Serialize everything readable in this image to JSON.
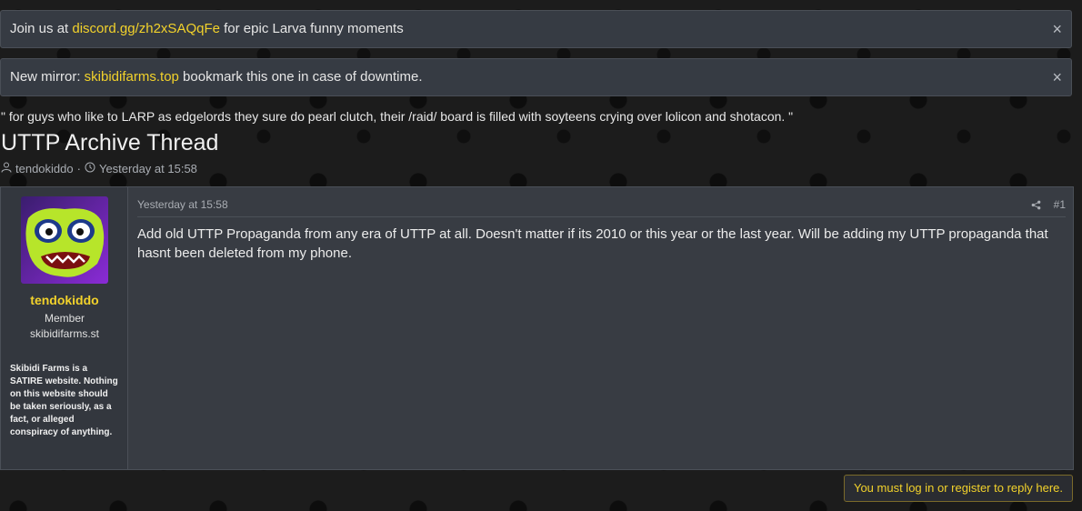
{
  "notices": [
    {
      "prefix": "Join us at ",
      "link": "discord.gg/zh2xSAQqFe",
      "suffix": " for epic Larva funny moments",
      "close_label": "×"
    },
    {
      "prefix": "New mirror: ",
      "link": "skibidifarms.top",
      "suffix": " bookmark this one in case of downtime.",
      "close_label": "×"
    }
  ],
  "quote": "\" for guys who like to LARP as edgelords they sure do pearl clutch, their /raid/ board is filled with soyteens crying over lolicon and shotacon. \"",
  "thread": {
    "title": "UTTP Archive Thread",
    "author": "tendokiddo",
    "separator": "·",
    "date": "Yesterday at 15:58"
  },
  "post": {
    "user": {
      "name": "tendokiddo",
      "title": "Member",
      "site": "skibidifarms.st",
      "disclaimer": "Skibidi Farms is a SATIRE website. Nothing on this website should be taken seriously, as a fact, or alleged conspiracy of anything."
    },
    "time": "Yesterday at 15:58",
    "number": "#1",
    "body": "Add old UTTP Propaganda from any era of UTTP at all. Doesn't matter if its 2010 or this year or the last year. Will be adding my UTTP propaganda that hasnt been deleted from my phone."
  },
  "reply_notice": "You must log in or register to reply here.",
  "colors": {
    "accent": "#f2d22b",
    "panel": "#383c43",
    "background": "#1c1c1c"
  }
}
